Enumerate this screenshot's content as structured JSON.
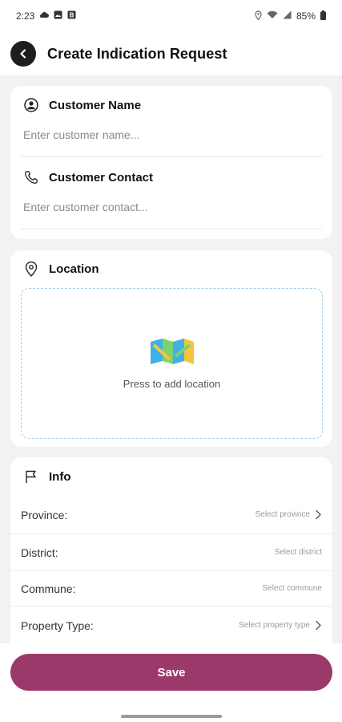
{
  "status_bar": {
    "time": "2:23",
    "battery": "85%",
    "left_icons": [
      "cloud-icon",
      "image-icon",
      "b-icon"
    ],
    "right_icons": [
      "location-icon",
      "wifi-icon",
      "signal-icon",
      "battery-icon"
    ]
  },
  "header": {
    "title": "Create Indication Request",
    "back_icon": "chevron-left-icon"
  },
  "customer": {
    "name_label": "Customer Name",
    "name_placeholder": "Enter customer name...",
    "contact_label": "Customer Contact",
    "contact_placeholder": "Enter customer contact..."
  },
  "location": {
    "label": "Location",
    "hint": "Press to add location",
    "map_icon": "folded-map-icon"
  },
  "info": {
    "label": "Info",
    "rows": [
      {
        "label": "Province:",
        "value": "Select province",
        "chevron": true
      },
      {
        "label": "District:",
        "value": "Select district",
        "chevron": false
      },
      {
        "label": "Commune:",
        "value": "Select commune",
        "chevron": false
      },
      {
        "label": "Property Type:",
        "value": "Select property type",
        "chevron": true
      }
    ]
  },
  "footer": {
    "save_label": "Save"
  },
  "colors": {
    "accent": "#9b3a6a",
    "back_button": "#1e1e1e",
    "dashed_border": "#a9cde6"
  }
}
